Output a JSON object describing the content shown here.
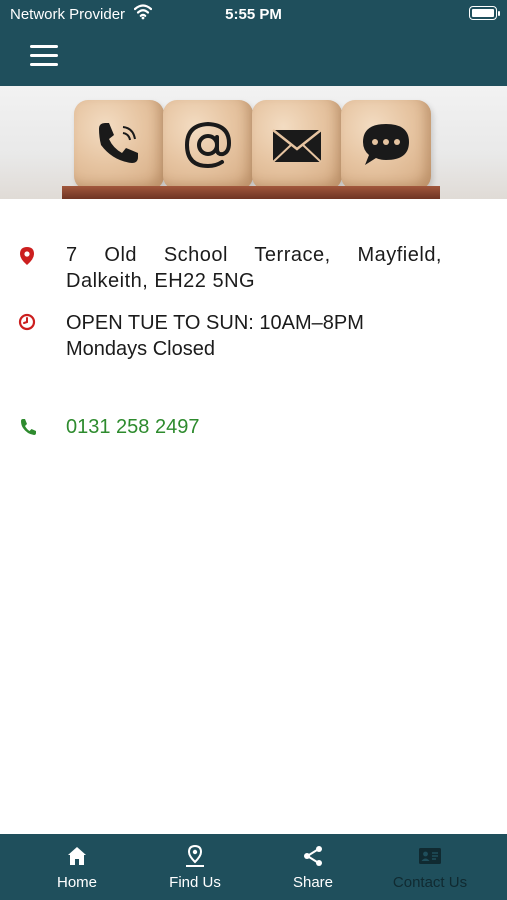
{
  "status_bar": {
    "carrier": "Network Provider",
    "time": "5:55 PM"
  },
  "header": {
    "menu_icon": "hamburger-icon"
  },
  "banner": {
    "cube_icons": [
      "phone-icon",
      "at-sign-icon",
      "envelope-icon",
      "chat-bubble-icon"
    ]
  },
  "contact": {
    "address": "7 Old School Terrace, Mayfield, Dalkeith, EH22 5NG",
    "hours_line1": "OPEN TUE TO SUN:  10AM–8PM",
    "hours_line2": "Mondays Closed",
    "phone": "0131 258 2497"
  },
  "nav": {
    "items": [
      {
        "label": "Home",
        "icon": "home-icon"
      },
      {
        "label": "Find Us",
        "icon": "map-pin-icon"
      },
      {
        "label": "Share",
        "icon": "share-icon"
      },
      {
        "label": "Contact Us",
        "icon": "contact-card-icon"
      }
    ],
    "active": "Contact Us"
  },
  "colors": {
    "header": "#1f4f5c",
    "icon_red": "#cc1f1f",
    "phone_green": "#2e8b2e",
    "active_nav": "#102a31"
  }
}
